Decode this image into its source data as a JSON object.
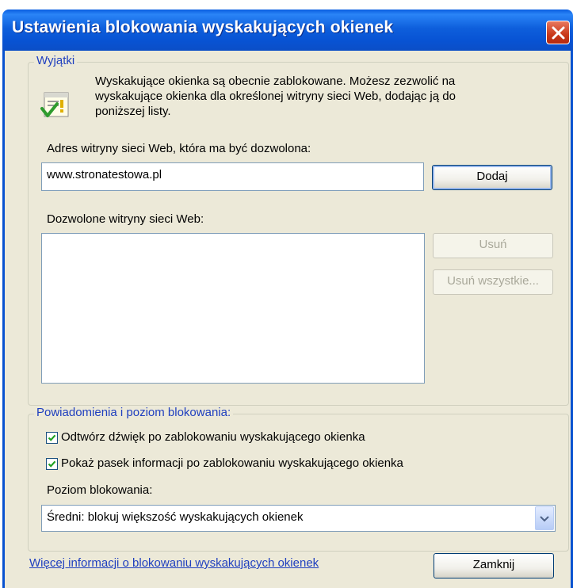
{
  "window": {
    "title": "Ustawienia blokowania wyskakujących okienek"
  },
  "exceptions": {
    "group_title": "Wyjątki",
    "info_line1": "Wyskakujące okienka są obecnie zablokowane. Możesz zezwolić na",
    "info_line2": "wyskakujące okienka dla określonej witryny sieci Web, dodając ją do",
    "info_line3": "poniższej listy.",
    "address_label": "Adres witryny sieci Web, która ma być dozwolona:",
    "address_value": "www.stronatestowa.pl",
    "add_button": "Dodaj",
    "allowed_label": "Dozwolone witryny sieci Web:",
    "allowed_sites": [],
    "remove_button": "Usuń",
    "remove_all_button": "Usuń wszystkie..."
  },
  "notifications": {
    "group_title": "Powiadomienia i poziom blokowania:",
    "play_sound_label": "Odtwórz dźwięk po zablokowaniu wyskakującego okienka",
    "play_sound_checked": true,
    "show_infobar_label": "Pokaż pasek informacji po zablokowaniu wyskakującego okienka",
    "show_infobar_checked": true,
    "level_label": "Poziom blokowania:",
    "level_value": "Średni: blokuj większość wyskakujących okienek"
  },
  "footer": {
    "more_info_link": "Więcej informacji o blokowaniu wyskakujących okienek",
    "close_button": "Zamknij"
  },
  "colors": {
    "titlebar": "#0a5ee0",
    "dialog_bg": "#ece9d8",
    "group_title": "#1f3fbf",
    "close_button": "#c9391b"
  }
}
